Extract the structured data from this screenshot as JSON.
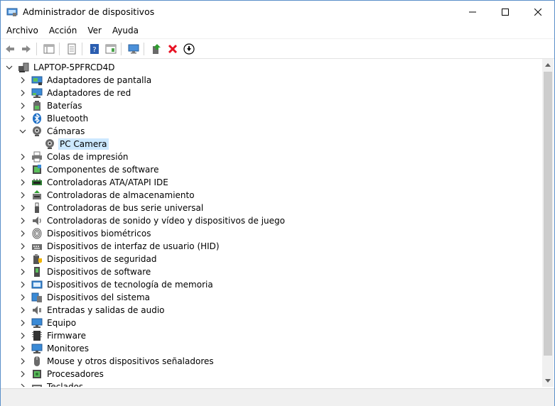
{
  "window": {
    "title": "Administrador de dispositivos"
  },
  "menu": [
    "Archivo",
    "Acción",
    "Ver",
    "Ayuda"
  ],
  "tree": {
    "root": "LAPTOP-5PFRCD4D",
    "items": [
      {
        "label": "Adaptadores de pantalla",
        "icon": "display-adapter-icon",
        "state": "collapsed"
      },
      {
        "label": "Adaptadores de red",
        "icon": "network-adapter-icon",
        "state": "collapsed"
      },
      {
        "label": "Baterías",
        "icon": "battery-icon",
        "state": "collapsed"
      },
      {
        "label": "Bluetooth",
        "icon": "bluetooth-icon",
        "state": "collapsed"
      },
      {
        "label": "Cámaras",
        "icon": "camera-icon",
        "state": "expanded"
      },
      {
        "label": "PC Camera",
        "icon": "camera-icon",
        "state": "child-selected"
      },
      {
        "label": "Colas de impresión",
        "icon": "printer-icon",
        "state": "collapsed"
      },
      {
        "label": "Componentes de software",
        "icon": "software-component-icon",
        "state": "collapsed"
      },
      {
        "label": "Controladoras ATA/ATAPI IDE",
        "icon": "ide-controller-icon",
        "state": "collapsed"
      },
      {
        "label": "Controladoras de almacenamiento",
        "icon": "storage-controller-icon",
        "state": "collapsed"
      },
      {
        "label": "Controladoras de bus serie universal",
        "icon": "usb-icon",
        "state": "collapsed"
      },
      {
        "label": "Controladoras de sonido y vídeo y dispositivos de juego",
        "icon": "speaker-icon",
        "state": "collapsed"
      },
      {
        "label": "Dispositivos biométricos",
        "icon": "fingerprint-icon",
        "state": "collapsed"
      },
      {
        "label": "Dispositivos de interfaz de usuario (HID)",
        "icon": "hid-icon",
        "state": "collapsed"
      },
      {
        "label": "Dispositivos de seguridad",
        "icon": "security-device-icon",
        "state": "collapsed"
      },
      {
        "label": "Dispositivos de software",
        "icon": "software-device-icon",
        "state": "collapsed"
      },
      {
        "label": "Dispositivos de tecnología de memoria",
        "icon": "memory-icon",
        "state": "collapsed"
      },
      {
        "label": "Dispositivos del sistema",
        "icon": "system-device-icon",
        "state": "collapsed"
      },
      {
        "label": "Entradas y salidas de audio",
        "icon": "audio-io-icon",
        "state": "collapsed"
      },
      {
        "label": "Equipo",
        "icon": "computer-icon",
        "state": "collapsed"
      },
      {
        "label": "Firmware",
        "icon": "firmware-icon",
        "state": "collapsed"
      },
      {
        "label": "Monitores",
        "icon": "monitor-icon",
        "state": "collapsed"
      },
      {
        "label": "Mouse y otros dispositivos señaladores",
        "icon": "mouse-icon",
        "state": "collapsed"
      },
      {
        "label": "Procesadores",
        "icon": "processor-icon",
        "state": "collapsed"
      },
      {
        "label": "Teclados",
        "icon": "keyboard-icon",
        "state": "collapsed"
      }
    ]
  },
  "colors": {
    "selection": "#cce8ff",
    "accent": "#1e6fc6",
    "delete": "#e81123"
  }
}
